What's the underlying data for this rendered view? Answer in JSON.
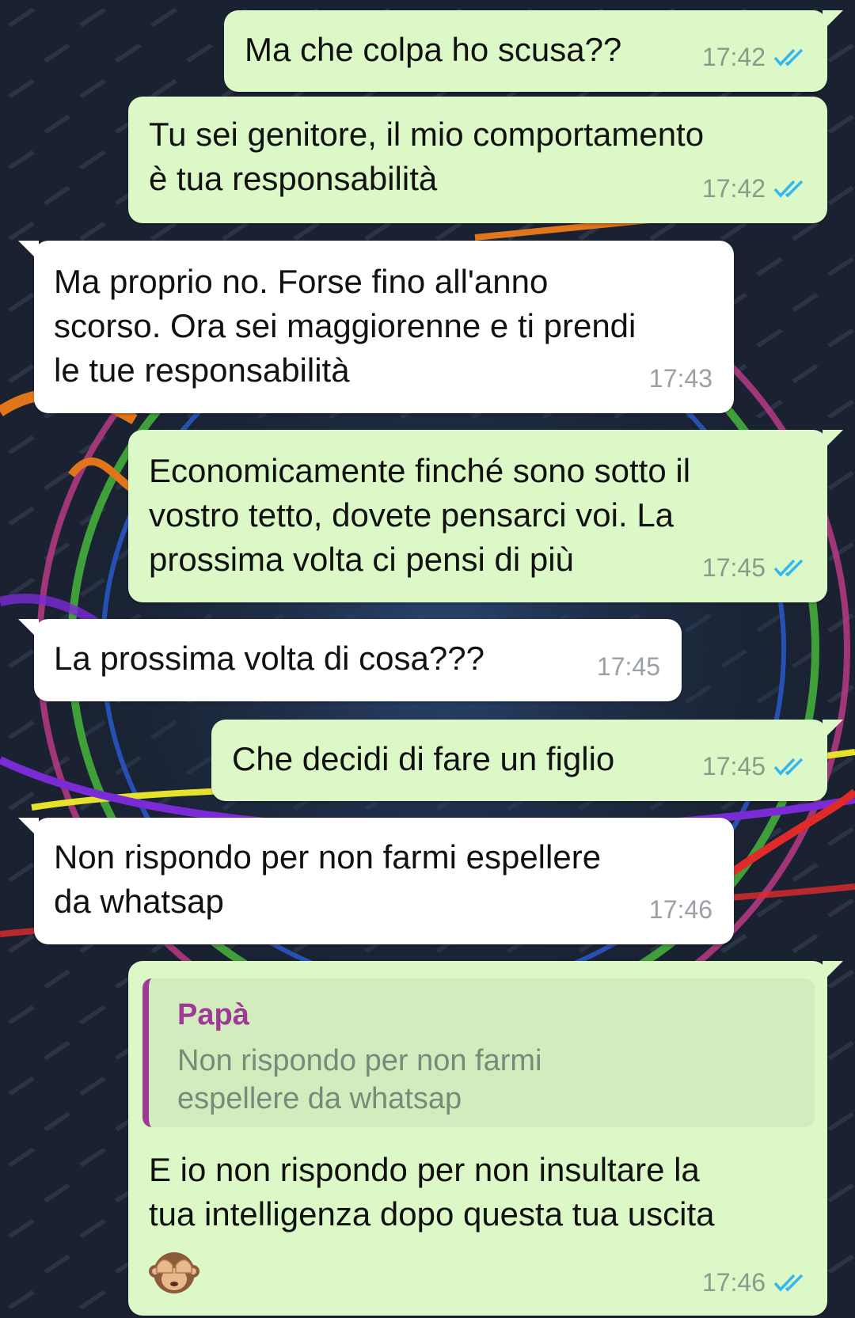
{
  "chat": {
    "messages": [
      {
        "text": "Ma che colpa ho scusa??",
        "time": "17:42",
        "status": "read"
      },
      {
        "text": "Tu sei genitore, il mio comportamento\nè tua responsabilità",
        "time": "17:42",
        "status": "read"
      },
      {
        "text": "Ma proprio no. Forse fino all'anno\nscorso. Ora sei maggiorenne e ti prendi\nle tue responsabilità",
        "time": "17:43"
      },
      {
        "text": "Economicamente finché sono sotto il\nvostro tetto, dovete pensarci voi. La\nprossima volta ci pensi di più",
        "time": "17:45",
        "status": "read"
      },
      {
        "text": "La prossima volta di cosa???",
        "time": "17:45"
      },
      {
        "text": "Che decidi di fare un figlio",
        "time": "17:45",
        "status": "read"
      },
      {
        "text": "Non rispondo per non farmi espellere\nda whatsap",
        "time": "17:46"
      },
      {
        "quote": {
          "author": "Papà",
          "text": "Non rispondo per non farmi\nespellere da whatsap"
        },
        "text": "E io non rispondo per non insultare la\ntua intelligenza dopo questa tua uscita",
        "emoji": "see-no-evil-monkey",
        "time": "17:46",
        "status": "read"
      }
    ]
  },
  "colors": {
    "outgoing_bubble": "#dcf8c6",
    "incoming_bubble": "#ffffff",
    "read_ticks": "#34b7f1",
    "quote_author": "#9c3a96"
  }
}
